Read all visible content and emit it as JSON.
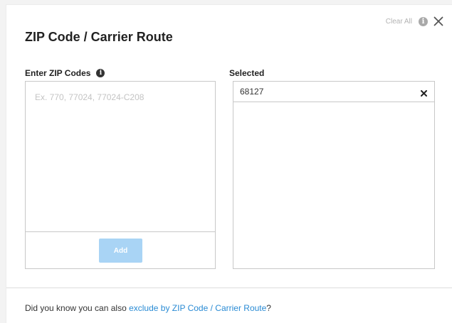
{
  "modal": {
    "title": "ZIP Code / Carrier Route",
    "clear_all_label": "Clear All",
    "info_icon": "i"
  },
  "enter_zip": {
    "label": "Enter ZIP Codes",
    "info_icon": "i",
    "placeholder": "Ex. 770, 77024, 77024-C208",
    "value": "",
    "add_button_label": "Add"
  },
  "selected": {
    "label": "Selected",
    "items": [
      {
        "value": "68127"
      }
    ]
  },
  "footer": {
    "text_before": "Did you know you can also ",
    "link_text": "exclude by ZIP Code / Carrier Route",
    "text_after": "?"
  },
  "colors": {
    "accent_link": "#2a8bd4",
    "add_button_disabled": "#a9d4f5",
    "border": "#c8c8c8"
  },
  "icons": [
    "info-icon",
    "close-icon",
    "remove-icon"
  ]
}
